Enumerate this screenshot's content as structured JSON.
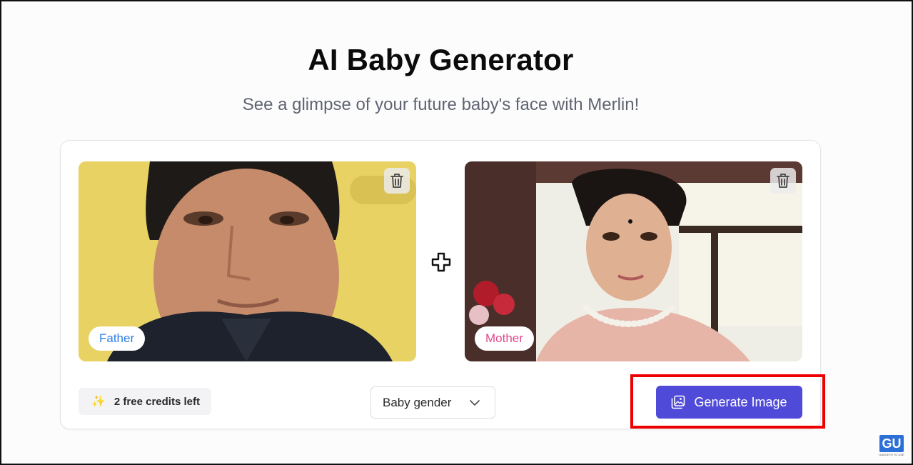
{
  "header": {
    "title": "AI Baby Generator",
    "subtitle": "See a glimpse of your future baby's face with Merlin!"
  },
  "parents": [
    {
      "label": "Father",
      "tag_color": "#2f7ee0",
      "delete_icon": "trash-icon"
    },
    {
      "label": "Mother",
      "tag_color": "#e0498c",
      "delete_icon": "trash-icon"
    }
  ],
  "combine_icon": "plus-icon",
  "footer": {
    "credits_label": "2 free credits left",
    "credits_icon": "sparkle-icon",
    "gender_select_value": "Baby gender",
    "gender_chevron_icon": "chevron-down-icon",
    "generate_label": "Generate Image",
    "generate_icon": "image-icon",
    "accent_color": "#4f4ad8"
  },
  "annotation": {
    "highlight_color": "#ee0000"
  },
  "watermark": {
    "text": "GU",
    "caption": "GADGETS TO USE"
  }
}
